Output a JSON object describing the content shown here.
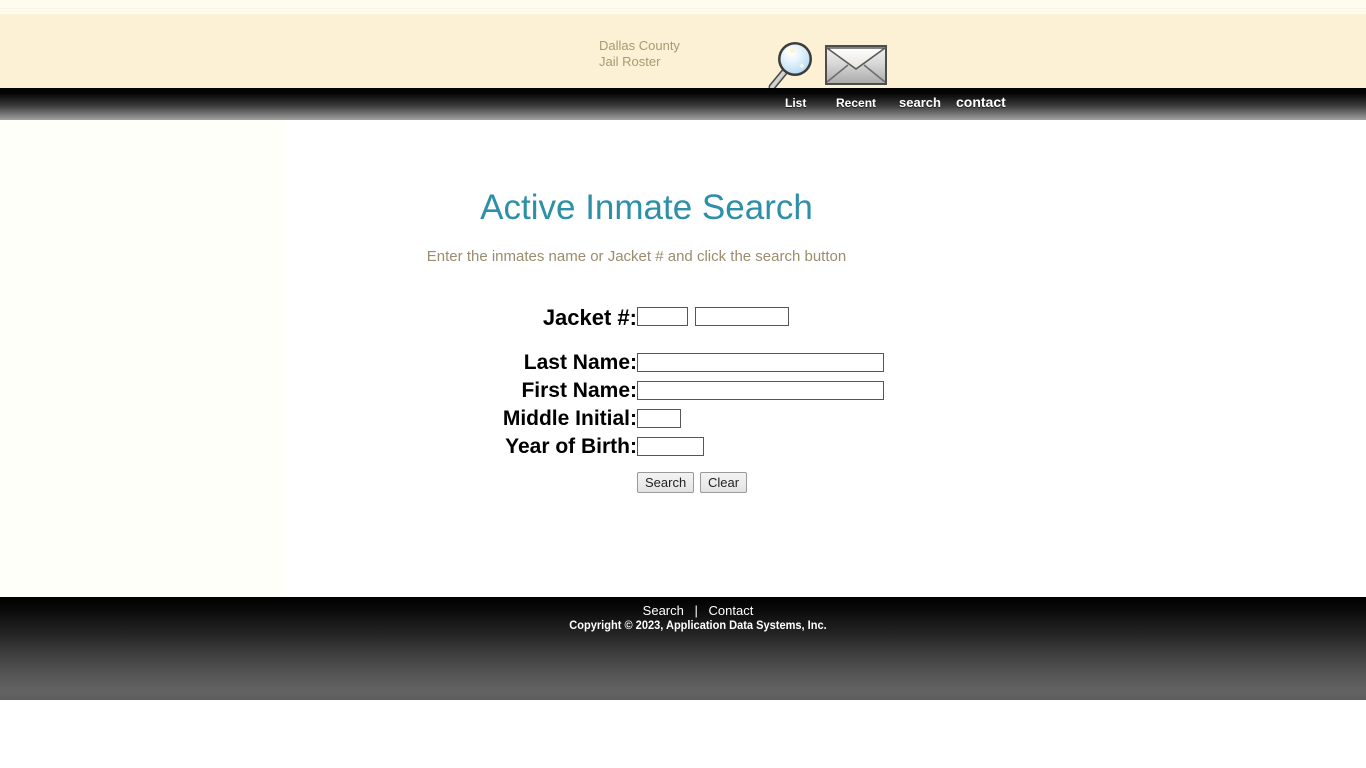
{
  "site": {
    "title_line1": "Dallas County",
    "title_line2": "Jail Roster",
    "header_bg": "#fcf1d4",
    "icons": [
      {
        "name": "magnifier-icon",
        "label": "search"
      },
      {
        "name": "envelope-icon",
        "label": "contact"
      }
    ]
  },
  "nav": {
    "items": [
      {
        "label": "List"
      },
      {
        "label": "Recent"
      },
      {
        "label": "search"
      },
      {
        "label": "contact"
      }
    ]
  },
  "main": {
    "title": "Active Inmate Search",
    "title_color": "#2e8fa8",
    "subtitle": "Enter the inmates name or Jacket # and click the search button",
    "subtitle_color": "#9b8c6e"
  },
  "form": {
    "fields": [
      {
        "label": "Jacket #:",
        "inputs": [
          {
            "name": "jacket-prefix-input",
            "value": "",
            "placeholder": ""
          },
          {
            "name": "jacket-number-input",
            "value": "",
            "placeholder": ""
          }
        ]
      },
      {
        "label": "Last Name:",
        "inputs": [
          {
            "name": "last-name-input",
            "value": "",
            "placeholder": ""
          }
        ]
      },
      {
        "label": "First Name:",
        "inputs": [
          {
            "name": "first-name-input",
            "value": "",
            "placeholder": ""
          }
        ]
      },
      {
        "label": "Middle Initial:",
        "inputs": [
          {
            "name": "middle-initial-input",
            "value": "",
            "placeholder": ""
          }
        ]
      },
      {
        "label": "Year of Birth:",
        "inputs": [
          {
            "name": "year-of-birth-input",
            "value": "",
            "placeholder": ""
          }
        ]
      }
    ],
    "buttons": {
      "search": "Search",
      "clear": "Clear"
    }
  },
  "footer": {
    "links": [
      {
        "label": "Search"
      },
      {
        "label": "Contact"
      }
    ],
    "separator": "|",
    "copyright": "Copyright © 2023, Application Data Systems, Inc."
  }
}
